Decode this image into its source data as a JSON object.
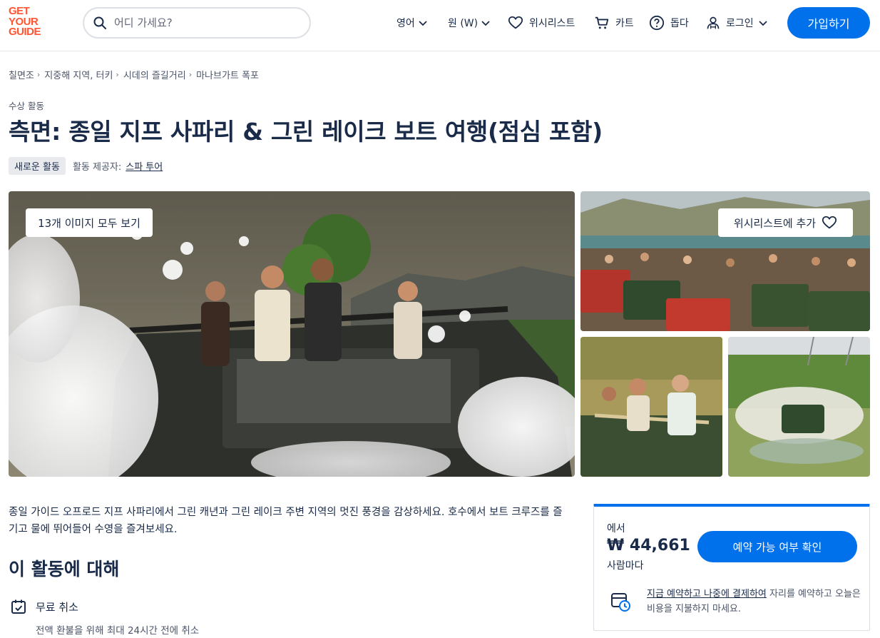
{
  "header": {
    "logo_lines": [
      "GET",
      "YOUR",
      "GUIDE"
    ],
    "search_placeholder": "어디 가세요?",
    "language": "영어",
    "currency": "원 (W)",
    "wishlist": "위시리스트",
    "cart": "카트",
    "help": "돕다",
    "login": "로그인",
    "signup": "가입하기"
  },
  "breadcrumb": [
    "칠면조",
    "지중해 지역, 터키",
    "시데의 즐길거리",
    "마나브가트 폭포"
  ],
  "activity": {
    "category": "수상 활동",
    "title": "측면: 종일 지프 사파리 & 그린 레이크 보트 여행(점심 포함)",
    "badge": "새로운 활동",
    "provider_label": "활동 제공자:",
    "provider_name": "스파 투어"
  },
  "gallery": {
    "view_all": "13개 이미지 모두 보기",
    "wishlist_add": "위시리스트에 추가",
    "images": [
      "jeep-foam-party",
      "jeep-group-lake",
      "jeep-passengers",
      "jeep-water-splash"
    ]
  },
  "description": "종일 가이드 오프로드 지프 사파리에서 그린 캐년과 그린 레이크 주변 지역의 멋진 풍경을 감상하세요. 호수에서 보트 크루즈를 즐기고 물에 뛰어들어 수영을 즐겨보세요.",
  "about": {
    "title": "이 활동에 대해",
    "feature_title": "무료 취소",
    "feature_sub": "전액 환불을 위해 최대 24시간 전에 취소"
  },
  "booking": {
    "from_label": "에서",
    "price": "₩ 44,661",
    "per_person": "사람마다",
    "check_button": "예약 가능 여부 확인",
    "rnpl_link": "지금 예약하고 나중에 결제하여",
    "rnpl_text": " 자리를 예약하고 오늘은 비용을 지불하지 마세요."
  },
  "colors": {
    "brand_orange": "#ff5533",
    "primary_blue": "#0071eb",
    "text_dark": "#1a2b49"
  }
}
